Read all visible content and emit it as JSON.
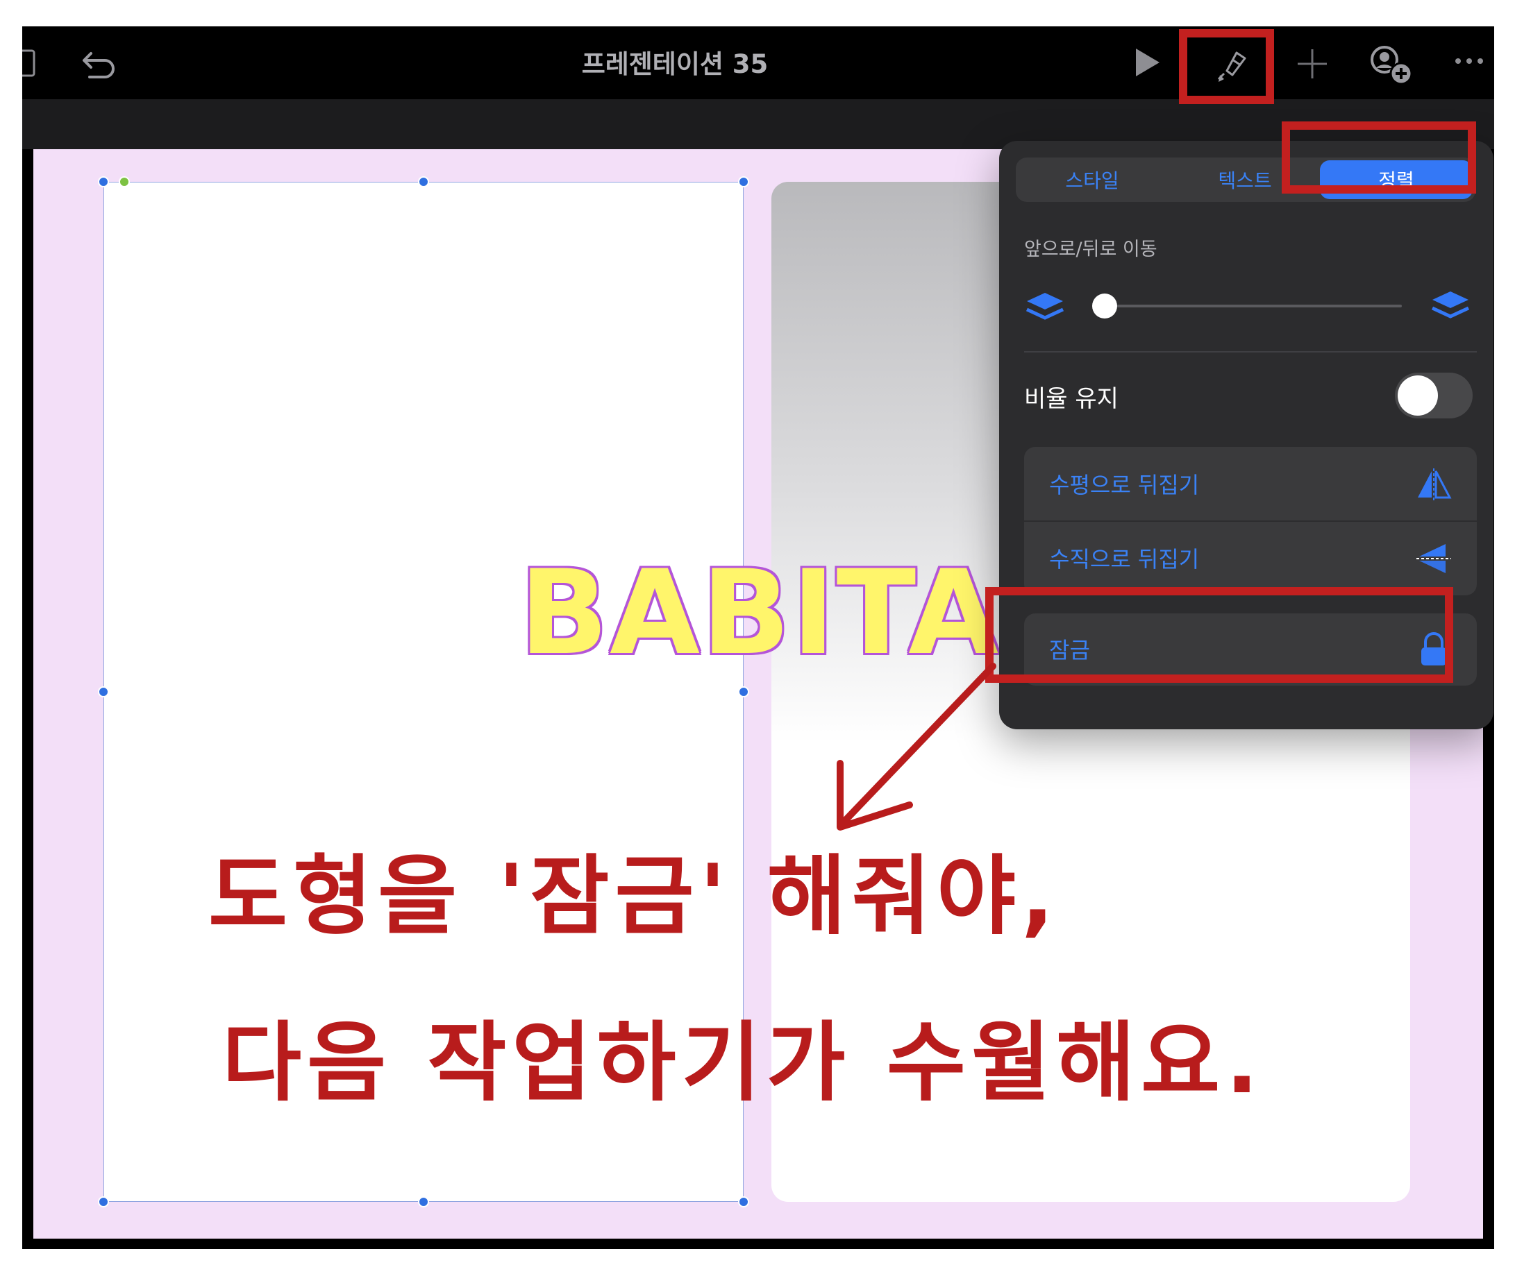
{
  "app": {
    "document_title": "프레젠테이션 35"
  },
  "toolbar": {
    "icons": [
      "sidebar-icon",
      "undo-icon",
      "play-icon",
      "format-brush-icon",
      "add-icon",
      "collaborate-icon",
      "more-icon"
    ]
  },
  "canvas": {
    "babita_text": "BABITA"
  },
  "format_panel": {
    "tabs": [
      {
        "label": "스타일",
        "active": false
      },
      {
        "label": "텍스트",
        "active": false
      },
      {
        "label": "정렬",
        "active": true
      }
    ],
    "move_section_label": "앞으로/뒤로 이동",
    "layer_position": 0,
    "aspect_ratio_label": "비율 유지",
    "aspect_ratio_on": false,
    "flip_horizontal_label": "수평으로 뒤집기",
    "flip_vertical_label": "수직으로 뒤집기",
    "lock_label": "잠금"
  },
  "annotation": {
    "line1": "도형을 '잠금' 해줘야,",
    "line2": "다음 작업하기가 수월해요.",
    "color": "#b81c1c"
  },
  "colors": {
    "accent": "#3478f6",
    "highlight_box": "#c3201f",
    "canvas_background": "#f3dff8"
  }
}
